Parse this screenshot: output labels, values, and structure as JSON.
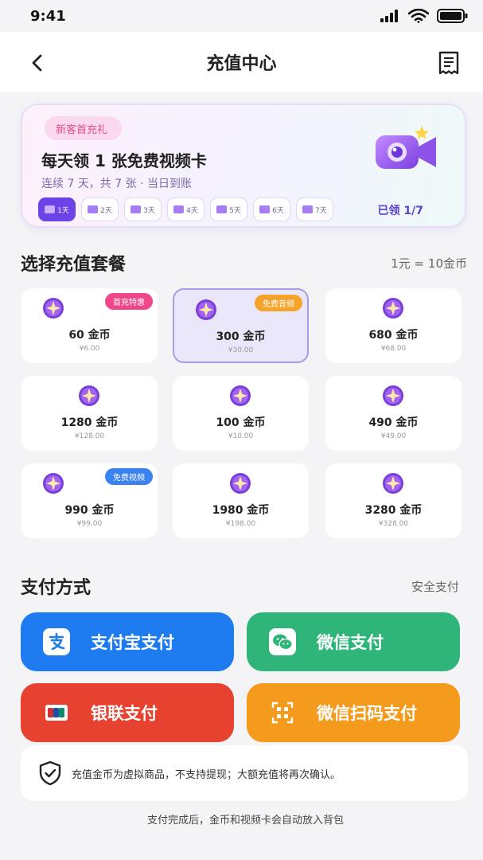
{
  "status_bar": {
    "time": "9:41"
  },
  "nav": {
    "title": "充值中心",
    "back_icon": "chevron-left-icon",
    "receipt_icon": "receipt-icon"
  },
  "promo": {
    "tag": "新客首充礼",
    "title": "每天领 1 张免费视频卡",
    "subtitle": "连续 7 天，共 7 张 · 当日到账",
    "days": [
      "1天",
      "2天",
      "3天",
      "4天",
      "5天",
      "6天",
      "7天"
    ],
    "active_day_index": 0,
    "claimed": "已领 1/7",
    "accent": "#6b43e6"
  },
  "packages": {
    "title": "选择充值套餐",
    "rate": "1元 = 10金币",
    "items": [
      {
        "coins": "60 金币",
        "price": "¥6.00",
        "badge": "首充特惠",
        "badge_color": "pink"
      },
      {
        "coins": "300 金币",
        "price": "¥30.00",
        "badge": "免费音频",
        "badge_color": "orange",
        "selected": true
      },
      {
        "coins": "680 金币",
        "price": "¥68.00"
      },
      {
        "coins": "1280 金币",
        "price": "¥128.00"
      },
      {
        "coins": "100 金币",
        "price": "¥10.00"
      },
      {
        "coins": "490 金币",
        "price": "¥49.00"
      },
      {
        "coins": "990 金币",
        "price": "¥99.00",
        "badge": "免费视频",
        "badge_color": "blue"
      },
      {
        "coins": "1980 金币",
        "price": "¥198.00"
      },
      {
        "coins": "3280 金币",
        "price": "¥328.00"
      }
    ]
  },
  "payment": {
    "title": "支付方式",
    "aside": "安全支付",
    "methods": [
      {
        "label": "支付宝支付",
        "icon": "alipay-icon",
        "color": "#1f7cf0"
      },
      {
        "label": "微信支付",
        "icon": "wechat-icon",
        "color": "#2fb57a"
      },
      {
        "label": "银联支付",
        "icon": "unionpay-card-icon",
        "color": "#e7412f"
      },
      {
        "label": "微信扫码支付",
        "icon": "qr-scan-icon",
        "color": "#f49a1c"
      }
    ]
  },
  "notice": "充值金币为虚拟商品，不支持提现；大额充值将再次确认。",
  "footer": "支付完成后，金币和视频卡会自动放入背包"
}
